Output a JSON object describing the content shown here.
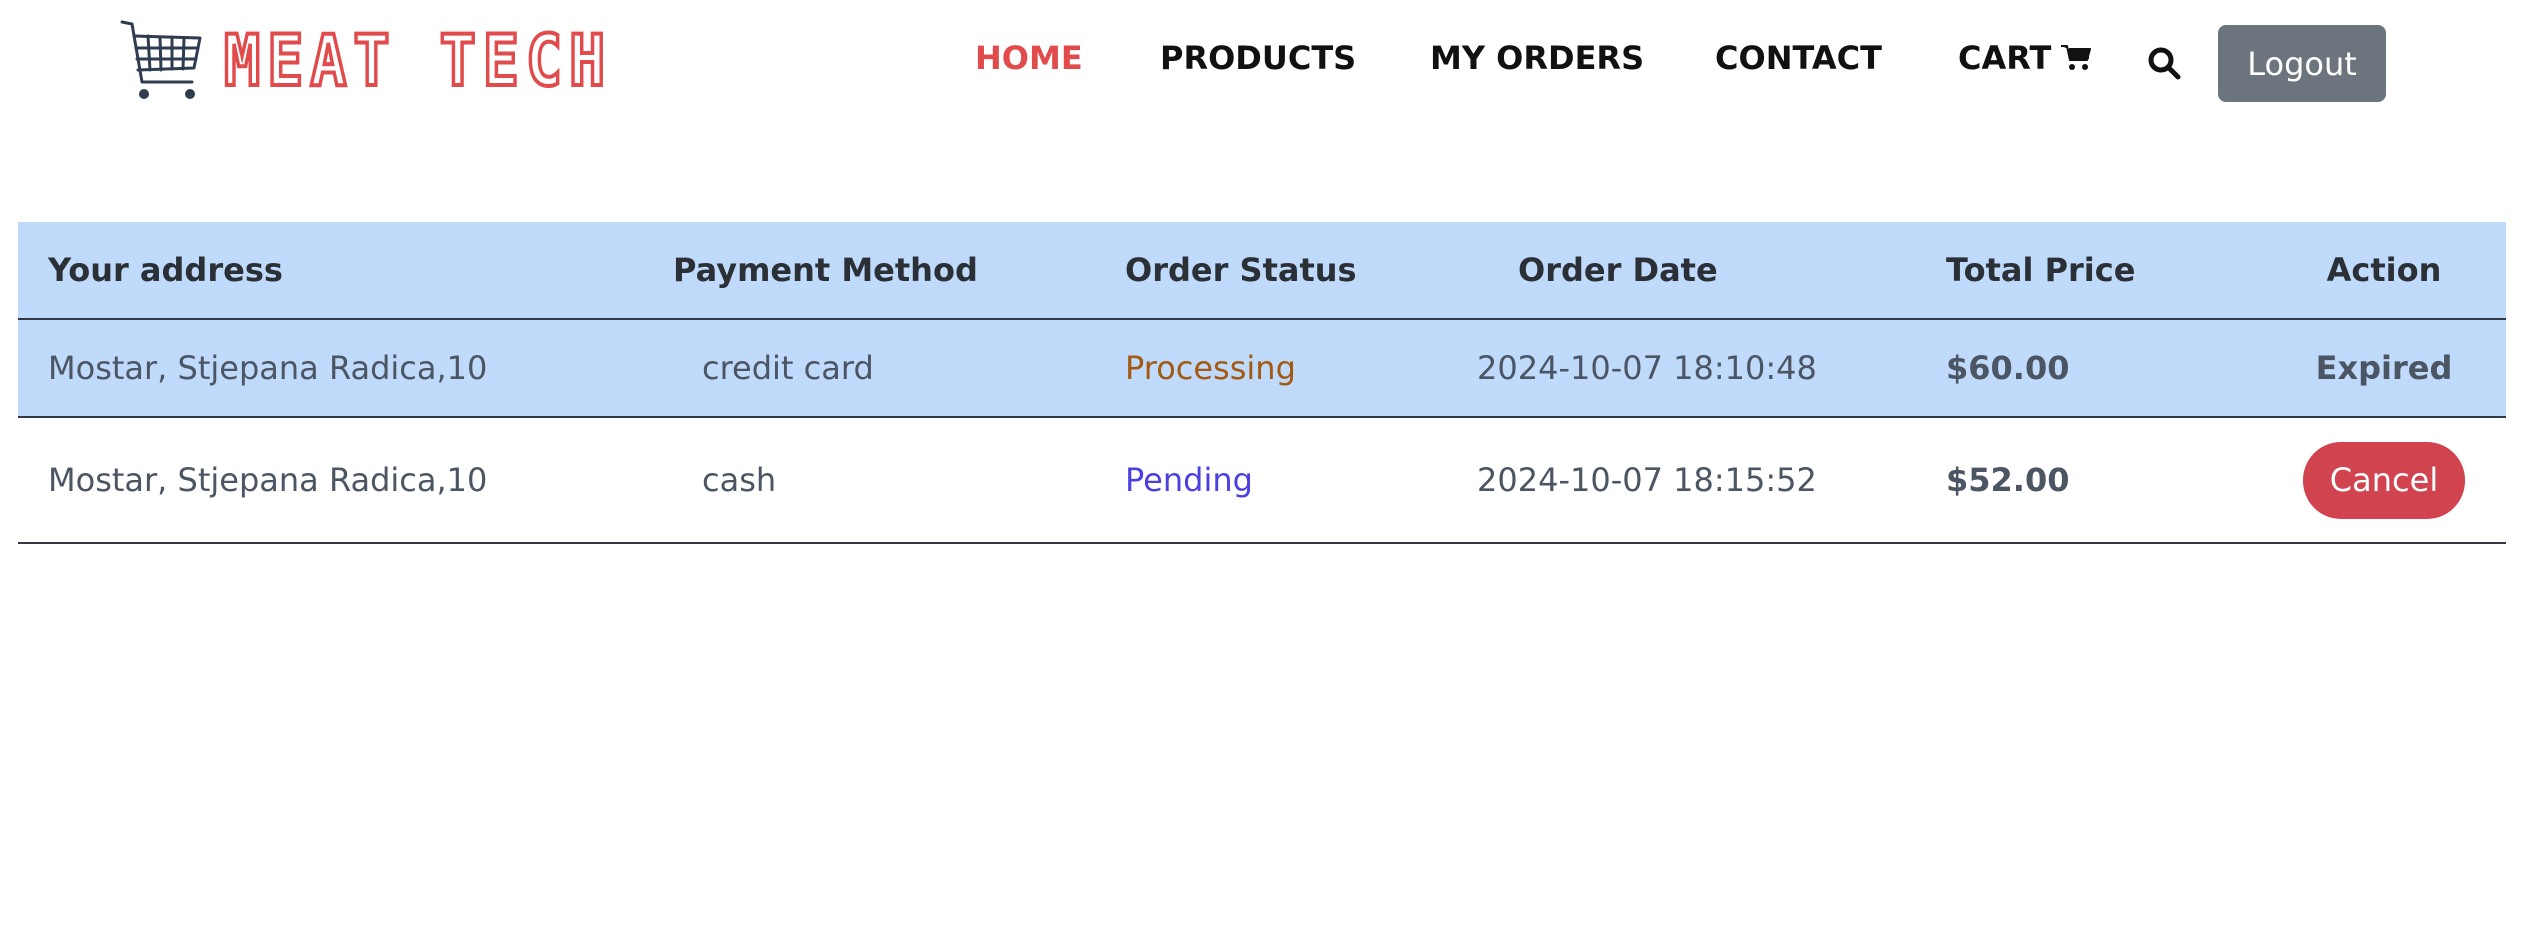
{
  "brand": {
    "name": "MEAT TECH",
    "logo_icon": "shopping-cart-icon",
    "color": "#e14b4b"
  },
  "nav": {
    "home": "HOME",
    "products": "PRODUCTS",
    "my_orders": "MY ORDERS",
    "contact": "CONTACT",
    "cart": "CART",
    "cart_icon": "cart-icon",
    "search_icon": "search-icon",
    "active_color": "#e14b4b"
  },
  "logout": {
    "label": "Logout",
    "color": "#6c757d"
  },
  "table": {
    "headers": {
      "address": "Your address",
      "payment": "Payment Method",
      "status": "Order Status",
      "date": "Order Date",
      "total": "Total Price",
      "action": "Action"
    },
    "rows": [
      {
        "address": "Mostar, Stjepana Radica,10",
        "payment": "credit card",
        "status": "Processing",
        "date": "2024-10-07 18:10:48",
        "total": "$60.00",
        "action": "Expired"
      },
      {
        "address": "Mostar, Stjepana Radica,10",
        "payment": "cash",
        "status": "Pending",
        "date": "2024-10-07 18:15:52",
        "total": "$52.00",
        "action": "Cancel"
      }
    ],
    "colors": {
      "header_bg": "#bfdafa",
      "processing": "#a35a10",
      "pending": "#4b3fe0",
      "cancel_button": "#d1434f"
    }
  }
}
